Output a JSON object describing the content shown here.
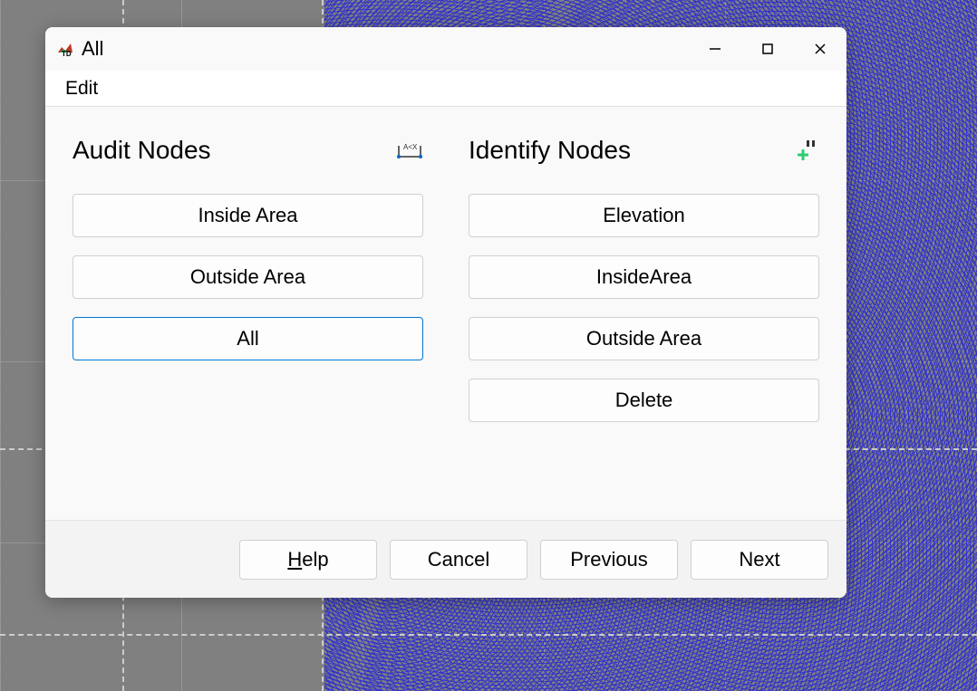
{
  "window": {
    "title": "All"
  },
  "menubar": {
    "edit": "Edit"
  },
  "audit": {
    "heading": "Audit Nodes",
    "buttons": {
      "inside": "Inside Area",
      "outside": "Outside Area",
      "all": "All"
    },
    "selected": "all"
  },
  "identify": {
    "heading": "Identify Nodes",
    "buttons": {
      "elevation": "Elevation",
      "inside": "InsideArea",
      "outside": "Outside Area",
      "delete": "Delete"
    }
  },
  "footer": {
    "help": "Help",
    "cancel": "Cancel",
    "previous": "Previous",
    "next": "Next"
  }
}
